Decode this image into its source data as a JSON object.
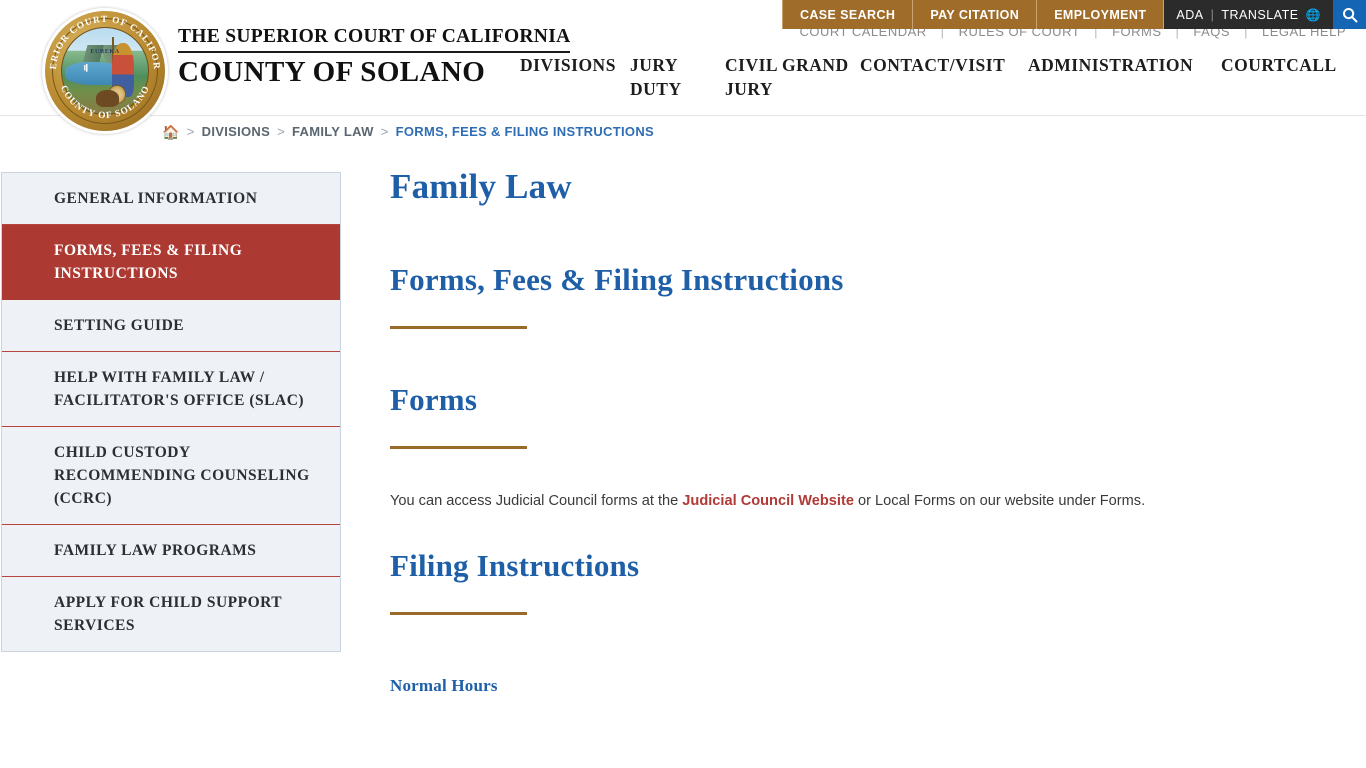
{
  "topbar": {
    "buttons": [
      {
        "label": "CASE SEARCH",
        "name": "case-search"
      },
      {
        "label": "PAY CITATION",
        "name": "pay-citation"
      },
      {
        "label": "EMPLOYMENT",
        "name": "employment"
      }
    ],
    "ada_label": "ADA",
    "separator": "|",
    "translate_label": "TRANSLATE",
    "globe_icon": "globe-icon",
    "search_icon": "search-icon",
    "button_color": "#a06c2a",
    "dark_color": "#2b2b2b",
    "search_color": "#1565b5"
  },
  "secondary_nav": {
    "items": [
      "COURT CALENDAR",
      "RULES OF COURT",
      "FORMS",
      "FAQS",
      "LEGAL HELP"
    ],
    "divider": "|"
  },
  "branding": {
    "seal_top_arc": "SUPERIOR COURT OF CALIFORNIA",
    "seal_bottom_arc": "COUNTY OF SOLANO",
    "seal_motto": "EUREKA",
    "title_line1": "THE SUPERIOR COURT OF CALIFORNIA",
    "title_line2": "COUNTY OF SOLANO"
  },
  "main_nav": {
    "items": [
      "DIVISIONS",
      "JURY DUTY",
      "CIVIL GRAND JURY",
      "CONTACT/VISIT",
      "ADMINISTRATION",
      "COURTCALL"
    ]
  },
  "breadcrumb": {
    "home_icon": "home-icon",
    "separator": ">",
    "items": [
      {
        "label": "DIVISIONS",
        "current": false
      },
      {
        "label": "FAMILY LAW",
        "current": false
      },
      {
        "label": "FORMS, FEES & FILING INSTRUCTIONS",
        "current": true
      }
    ]
  },
  "sidebar": {
    "items": [
      {
        "label": "GENERAL INFORMATION",
        "active": false
      },
      {
        "label": "FORMS, FEES & FILING INSTRUCTIONS",
        "active": true
      },
      {
        "label": "SETTING GUIDE",
        "active": false
      },
      {
        "label": "HELP WITH FAMILY LAW / FACILITATOR'S OFFICE (SLAC)",
        "active": false
      },
      {
        "label": "CHILD CUSTODY RECOMMENDING COUNSELING (CCRC)",
        "active": false
      },
      {
        "label": "FAMILY LAW PROGRAMS",
        "active": false
      },
      {
        "label": "APPLY FOR CHILD SUPPORT SERVICES",
        "active": false
      }
    ],
    "active_color": "#ac3a32",
    "background_color": "#eef2f7"
  },
  "content": {
    "page_title": "Family Law",
    "section_title": "Forms, Fees & Filing Instructions",
    "forms_heading": "Forms",
    "forms_paragraph_before": "You can access Judicial Council forms at the ",
    "forms_link": "Judicial Council Website",
    "forms_paragraph_after": " or Local Forms on our website under Forms.",
    "filing_heading": "Filing Instructions",
    "normal_hours_heading": "Normal Hours",
    "heading_color": "#1e5fa8",
    "rule_color": "#9a6a28",
    "link_color": "#b03a35"
  }
}
